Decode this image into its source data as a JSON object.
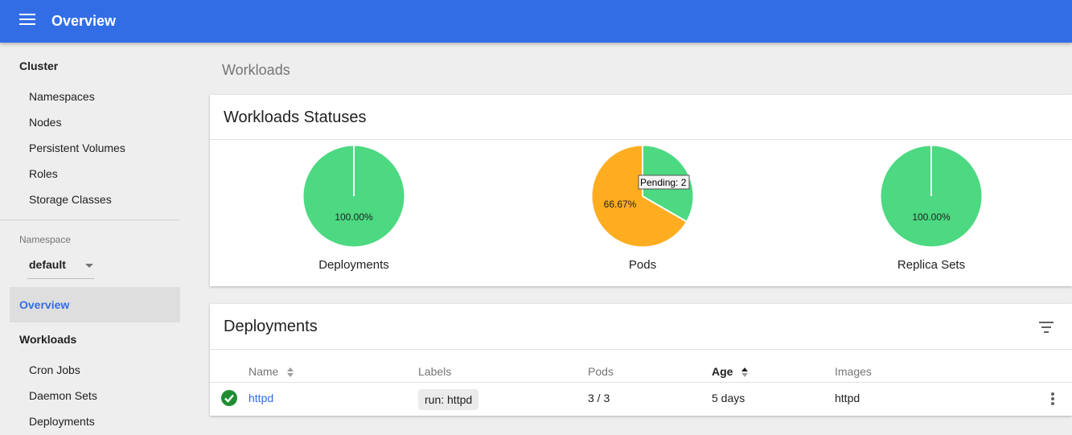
{
  "app": {
    "title": "Overview"
  },
  "sidebar": {
    "cluster_heading": "Cluster",
    "cluster_items": [
      "Namespaces",
      "Nodes",
      "Persistent Volumes",
      "Roles",
      "Storage Classes"
    ],
    "namespace_label": "Namespace",
    "namespace_value": "default",
    "active_item": "Overview",
    "workloads_heading": "Workloads",
    "workloads_items": [
      "Cron Jobs",
      "Daemon Sets",
      "Deployments"
    ]
  },
  "breadcrumb": "Workloads",
  "statuses": {
    "title": "Workloads Statuses",
    "charts": [
      {
        "label": "Deployments",
        "percent_text": "100.00%",
        "slices": [
          {
            "status": "running",
            "value": 100,
            "color": "#4cd981"
          }
        ]
      },
      {
        "label": "Pods",
        "percent_text": "66.67%",
        "tooltip": "Pending: 2",
        "slices": [
          {
            "status": "running",
            "value": 33.33,
            "color": "#4cd981"
          },
          {
            "status": "pending",
            "value": 66.67,
            "color": "#ffad20"
          }
        ]
      },
      {
        "label": "Replica Sets",
        "percent_text": "100.00%",
        "slices": [
          {
            "status": "running",
            "value": 100,
            "color": "#4cd981"
          }
        ]
      }
    ]
  },
  "deployments": {
    "title": "Deployments",
    "columns": {
      "name": "Name",
      "labels": "Labels",
      "pods": "Pods",
      "age": "Age",
      "images": "Images"
    },
    "rows": [
      {
        "name": "httpd",
        "label": "run: httpd",
        "pods": "3 / 3",
        "age": "5 days",
        "images": "httpd",
        "status_color": "#1f8e33"
      }
    ]
  },
  "colors": {
    "primary": "#326de6",
    "running": "#4cd981",
    "pending": "#ffad20"
  }
}
